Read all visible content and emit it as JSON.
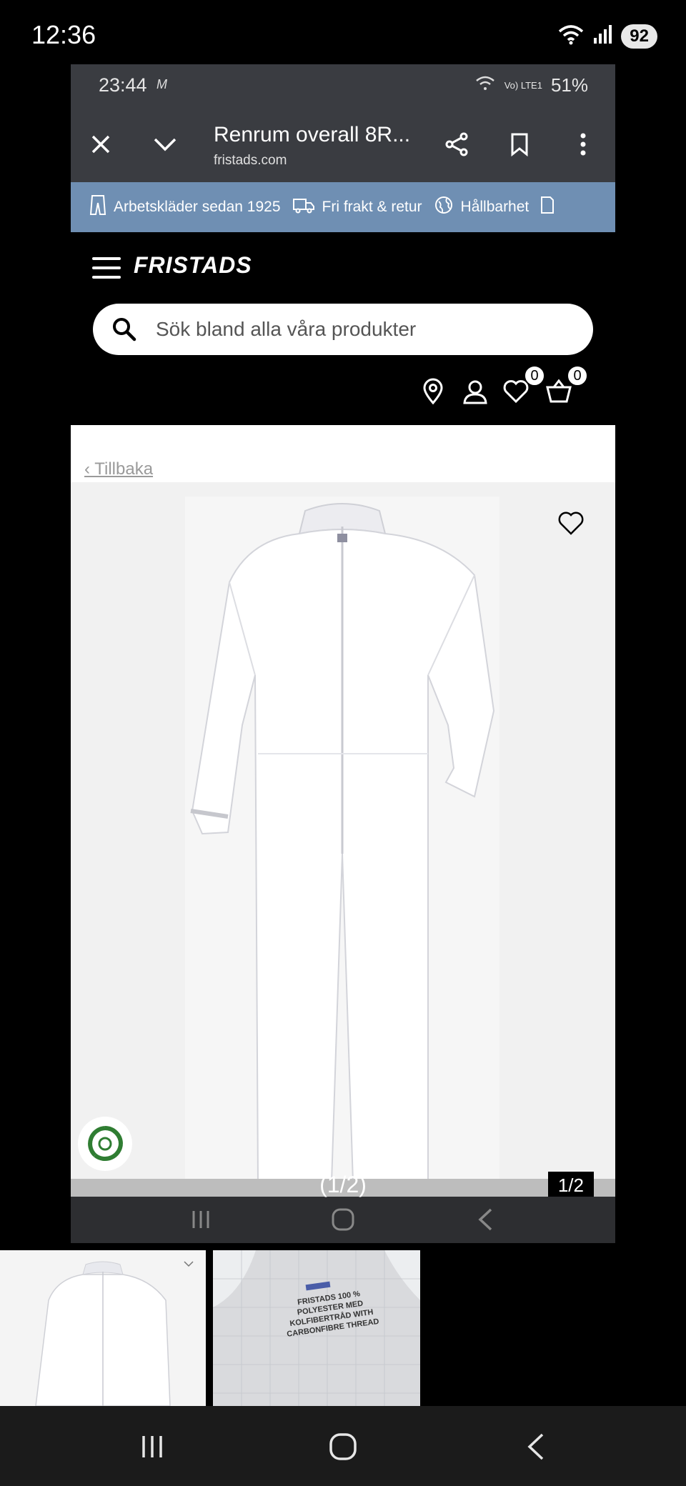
{
  "outer_status": {
    "time": "12:36",
    "wifi_label": "6",
    "battery": "92"
  },
  "inner_status": {
    "time": "23:44",
    "carrier": "M",
    "network": "Vo) LTE1",
    "battery": "51%"
  },
  "browser": {
    "title": "Renrum overall 8R...",
    "url": "fristads.com"
  },
  "promo": {
    "items": [
      "Arbetskläder sedan 1925",
      "Fri frakt & retur",
      "Hållbarhet"
    ]
  },
  "site": {
    "logo": "FRISTADS",
    "search_placeholder": "Sök bland alla våra produkter",
    "wishlist_count": "0",
    "cart_count": "0"
  },
  "product": {
    "back_label": "‹ Tillbaka",
    "image_counter": "1/2"
  },
  "viewer": {
    "label": "(1/2)"
  },
  "thumbnails": [
    {
      "label": ""
    },
    {
      "label": "FRISTADS 100 % POLYESTER MED KOLFIBERTRÅD WITH CARBONFIBRE THREAD"
    }
  ],
  "colors": {
    "promo_bg": "#6f8fb3",
    "browser_bg": "#3a3c41",
    "accent": "#000000"
  }
}
